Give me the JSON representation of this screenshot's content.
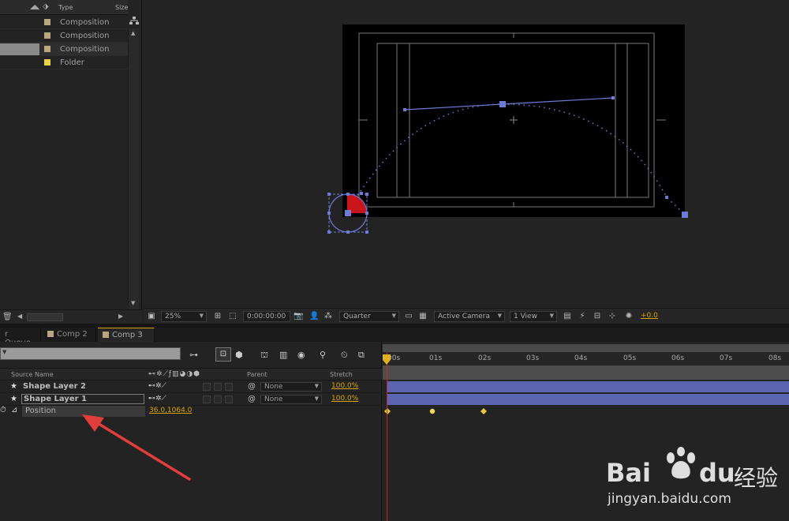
{
  "project": {
    "columns": {
      "type": "Type",
      "size": "Size"
    },
    "items": [
      {
        "type": "Composition",
        "color": "#b9a77f",
        "selected": false
      },
      {
        "type": "Composition",
        "color": "#b9a77f",
        "selected": false
      },
      {
        "type": "Composition",
        "color": "#b9a77f",
        "selected": true
      },
      {
        "type": "Folder",
        "color": "#e7d44a",
        "selected": false
      }
    ]
  },
  "viewer_toolbar": {
    "zoom": "25%",
    "timecode": "0:00:00:00",
    "resolution": "Quarter",
    "camera": "Active Camera",
    "views": "1 View",
    "exposure": "+0.0"
  },
  "timeline": {
    "tabs": [
      {
        "label": "r Queue",
        "active": false
      },
      {
        "label": "Comp 2",
        "active": false
      },
      {
        "label": "Comp 3",
        "active": true
      }
    ],
    "columns": {
      "source_name": "Source Name",
      "parent": "Parent",
      "stretch": "Stretch"
    },
    "layers": [
      {
        "name": "Shape Layer 2",
        "parent": "None",
        "stretch": "100.0%"
      },
      {
        "name": "Shape Layer 1",
        "parent": "None",
        "stretch": "100.0%"
      }
    ],
    "property": {
      "name": "Position",
      "value": "36.0,1064.0"
    },
    "ruler": [
      "00s",
      "01s",
      "02s",
      "03s",
      "04s",
      "05s",
      "06s",
      "07s",
      "08s"
    ],
    "colors": {
      "accent": "#d6a500",
      "layer_bar": "#5b66b2",
      "playhead": "#c8282a"
    }
  },
  "watermark": {
    "brand": "Bai",
    "brand_du": "du",
    "cn": "经验",
    "url": "jingyan.baidu.com"
  }
}
